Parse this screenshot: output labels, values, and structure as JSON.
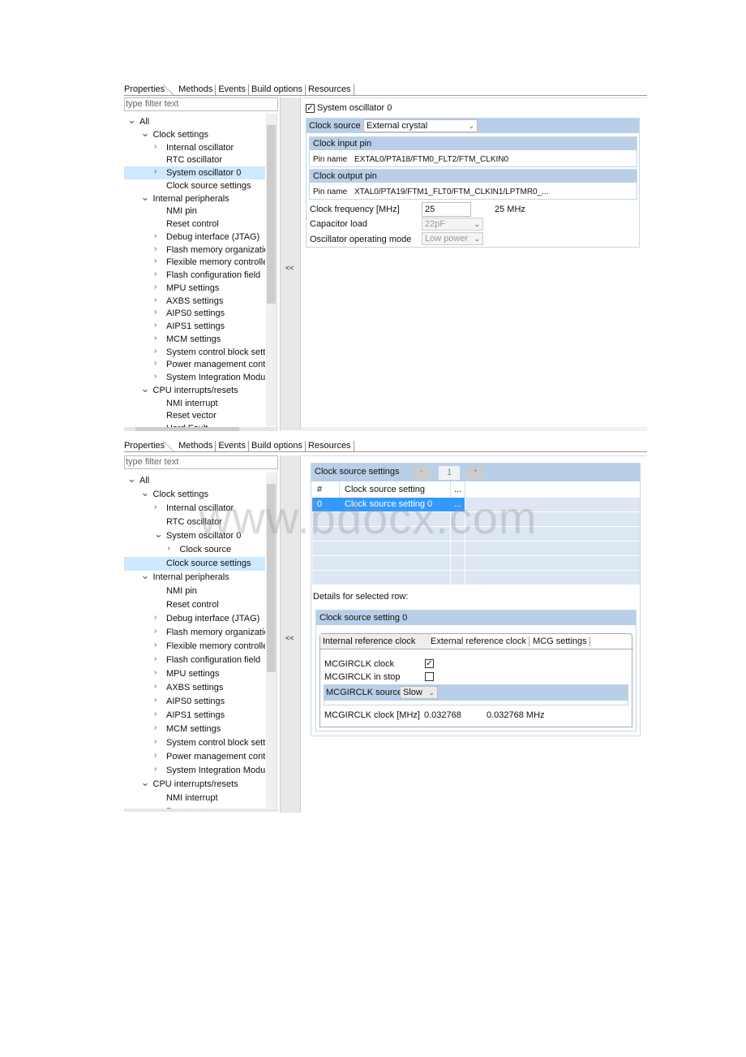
{
  "tabs": [
    "Properties",
    "Methods",
    "Events",
    "Build options",
    "Resources"
  ],
  "filter_placeholder": "type filter text",
  "collapse_button": "<<",
  "tree1": [
    {
      "label": "All",
      "level": 0,
      "chev": "v"
    },
    {
      "label": "Clock settings",
      "level": 1,
      "chev": "v"
    },
    {
      "label": "Internal oscillator",
      "level": 2,
      "chev": ">"
    },
    {
      "label": "RTC oscillator",
      "level": 2,
      "chev": ""
    },
    {
      "label": "System oscillator 0",
      "level": 2,
      "chev": ">",
      "selected": true
    },
    {
      "label": "Clock source settings",
      "level": 2,
      "chev": ""
    },
    {
      "label": "Internal peripherals",
      "level": 1,
      "chev": "v"
    },
    {
      "label": "NMI pin",
      "level": 2,
      "chev": ""
    },
    {
      "label": "Reset control",
      "level": 2,
      "chev": ""
    },
    {
      "label": "Debug interface (JTAG)",
      "level": 2,
      "chev": ">"
    },
    {
      "label": "Flash memory organization",
      "level": 2,
      "chev": ">"
    },
    {
      "label": "Flexible memory controller",
      "level": 2,
      "chev": ">"
    },
    {
      "label": "Flash configuration field",
      "level": 2,
      "chev": ">"
    },
    {
      "label": "MPU settings",
      "level": 2,
      "chev": ">"
    },
    {
      "label": "AXBS settings",
      "level": 2,
      "chev": ">"
    },
    {
      "label": "AIPS0 settings",
      "level": 2,
      "chev": ">"
    },
    {
      "label": "AIPS1 settings",
      "level": 2,
      "chev": ">"
    },
    {
      "label": "MCM settings",
      "level": 2,
      "chev": ">"
    },
    {
      "label": "System control block settings",
      "level": 2,
      "chev": ">"
    },
    {
      "label": "Power management controller",
      "level": 2,
      "chev": ">"
    },
    {
      "label": "System Integration Module",
      "level": 2,
      "chev": ">"
    },
    {
      "label": "CPU interrupts/resets",
      "level": 1,
      "chev": "v"
    },
    {
      "label": "NMI interrupt",
      "level": 2,
      "chev": ""
    },
    {
      "label": "Reset vector",
      "level": 2,
      "chev": ""
    },
    {
      "label": "Hard Fault",
      "level": 2,
      "chev": ""
    }
  ],
  "tree2": [
    {
      "label": "All",
      "level": 0,
      "chev": "v"
    },
    {
      "label": "Clock settings",
      "level": 1,
      "chev": "v"
    },
    {
      "label": "Internal oscillator",
      "level": 2,
      "chev": ">"
    },
    {
      "label": "RTC oscillator",
      "level": 2,
      "chev": ""
    },
    {
      "label": "System oscillator 0",
      "level": 2,
      "chev": "v"
    },
    {
      "label": "Clock source",
      "level": 3,
      "chev": ">"
    },
    {
      "label": "Clock source settings",
      "level": 2,
      "chev": "",
      "selected": true
    },
    {
      "label": "Internal peripherals",
      "level": 1,
      "chev": "v"
    },
    {
      "label": "NMI pin",
      "level": 2,
      "chev": ""
    },
    {
      "label": "Reset control",
      "level": 2,
      "chev": ""
    },
    {
      "label": "Debug interface (JTAG)",
      "level": 2,
      "chev": ">"
    },
    {
      "label": "Flash memory organization",
      "level": 2,
      "chev": ">"
    },
    {
      "label": "Flexible memory controller",
      "level": 2,
      "chev": ">"
    },
    {
      "label": "Flash configuration field",
      "level": 2,
      "chev": ">"
    },
    {
      "label": "MPU settings",
      "level": 2,
      "chev": ">"
    },
    {
      "label": "AXBS settings",
      "level": 2,
      "chev": ">"
    },
    {
      "label": "AIPS0 settings",
      "level": 2,
      "chev": ">"
    },
    {
      "label": "AIPS1 settings",
      "level": 2,
      "chev": ">"
    },
    {
      "label": "MCM settings",
      "level": 2,
      "chev": ">"
    },
    {
      "label": "System control block settings",
      "level": 2,
      "chev": ">"
    },
    {
      "label": "Power management controller",
      "level": 2,
      "chev": ">"
    },
    {
      "label": "System Integration Module",
      "level": 2,
      "chev": ">"
    },
    {
      "label": "CPU interrupts/resets",
      "level": 1,
      "chev": "v"
    },
    {
      "label": "NMI interrupt",
      "level": 2,
      "chev": ""
    },
    {
      "label": "Reset vector",
      "level": 2,
      "chev": ""
    }
  ],
  "osc": {
    "enable_label": "System oscillator 0",
    "enabled": true,
    "clock_source_label": "Clock source",
    "clock_source_value": "External crystal",
    "input_pin_header": "Clock input pin",
    "input_pin_label": "Pin name",
    "input_pin_value": "EXTAL0/PTA18/FTM0_FLT2/FTM_CLKIN0",
    "output_pin_header": "Clock output pin",
    "output_pin_label": "Pin name",
    "output_pin_value": "XTAL0/PTA19/FTM1_FLT0/FTM_CLKIN1/LPTMR0_...",
    "freq_label": "Clock frequency [MHz]",
    "freq_value": "25",
    "freq_display": "25 MHz",
    "cap_label": "Capacitor load",
    "cap_value": "22pF",
    "mode_label": "Oscillator operating mode",
    "mode_value": "Low power"
  },
  "css": {
    "title": "Clock source settings",
    "minus": "-",
    "count": "1",
    "plus": "+",
    "columns": [
      "#",
      "Clock source setting",
      "..."
    ],
    "rows": [
      {
        "index": "0",
        "name": "Clock source setting 0",
        "more": "..."
      }
    ],
    "details_label": "Details for selected row:",
    "detail_header": "Clock source setting 0",
    "detail_tabs": [
      "Internal reference clock",
      "External reference clock",
      "MCG settings"
    ],
    "mcgirclk_clock_label": "MCGIRCLK clock",
    "mcgirclk_clock_checked": true,
    "mcgirclk_stop_label": "MCGIRCLK in stop",
    "mcgirclk_stop_checked": false,
    "source_label": "MCGIRCLK source",
    "source_value": "Slow",
    "freq_label": "MCGIRCLK clock [MHz]",
    "freq_value": "0.032768",
    "freq_display": "0.032768 MHz"
  },
  "watermark": "www.bdocx.com",
  "colors": {
    "header": "#b9cfe8",
    "selected_row": "#3399ff",
    "tree_selected": "#cde8ff"
  }
}
